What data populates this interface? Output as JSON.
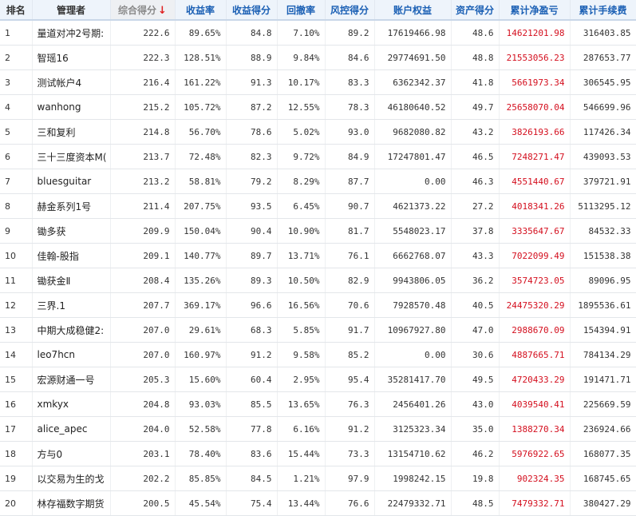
{
  "headers": {
    "rank": "排名",
    "manager": "管理者",
    "composite": "综合得分",
    "return_rate": "收益率",
    "return_score": "收益得分",
    "drawdown": "回撤率",
    "risk_score": "风控得分",
    "equity": "账户权益",
    "asset_score": "资产得分",
    "net_pnl": "累计净盈亏",
    "fees": "累计手续费"
  },
  "sort_indicator": "↓",
  "colors": {
    "header_link": "#1a5fb4",
    "pnl_text": "#d40f1e"
  },
  "rows": [
    [
      "1",
      "量道对冲2号期:",
      "222.6",
      "89.65%",
      "84.8",
      "7.10%",
      "89.2",
      "17619466.98",
      "48.6",
      "14621201.98",
      "316403.85"
    ],
    [
      "2",
      "智瑶16",
      "222.3",
      "128.51%",
      "88.9",
      "9.84%",
      "84.6",
      "29774691.50",
      "48.8",
      "21553056.23",
      "287653.77"
    ],
    [
      "3",
      "测试帐户4",
      "216.4",
      "161.22%",
      "91.3",
      "10.17%",
      "83.3",
      "6362342.37",
      "41.8",
      "5661973.34",
      "306545.95"
    ],
    [
      "4",
      "wanhong",
      "215.2",
      "105.72%",
      "87.2",
      "12.55%",
      "78.3",
      "46180640.52",
      "49.7",
      "25658070.04",
      "546699.96"
    ],
    [
      "5",
      "三和复利",
      "214.8",
      "56.70%",
      "78.6",
      "5.02%",
      "93.0",
      "9682080.82",
      "43.2",
      "3826193.66",
      "117426.34"
    ],
    [
      "6",
      "三十三度资本M(",
      "213.7",
      "72.48%",
      "82.3",
      "9.72%",
      "84.9",
      "17247801.47",
      "46.5",
      "7248271.47",
      "439093.53"
    ],
    [
      "7",
      "bluesguitar",
      "213.2",
      "58.81%",
      "79.2",
      "8.29%",
      "87.7",
      "0.00",
      "46.3",
      "4551440.67",
      "379721.91"
    ],
    [
      "8",
      "赫金系列1号",
      "211.4",
      "207.75%",
      "93.5",
      "6.45%",
      "90.7",
      "4621373.22",
      "27.2",
      "4018341.26",
      "5113295.12"
    ],
    [
      "9",
      "锄多获",
      "209.9",
      "150.04%",
      "90.4",
      "10.90%",
      "81.7",
      "5548023.17",
      "37.8",
      "3335647.67",
      "84532.33"
    ],
    [
      "10",
      "佳翰-股指",
      "209.1",
      "140.77%",
      "89.7",
      "13.71%",
      "76.1",
      "6662768.07",
      "43.3",
      "7022099.49",
      "151538.38"
    ],
    [
      "11",
      "锄获金Ⅱ",
      "208.4",
      "135.26%",
      "89.3",
      "10.50%",
      "82.9",
      "9943806.05",
      "36.2",
      "3574723.05",
      "89096.95"
    ],
    [
      "12",
      "三界.1",
      "207.7",
      "369.17%",
      "96.6",
      "16.56%",
      "70.6",
      "7928570.48",
      "40.5",
      "24475320.29",
      "1895536.61"
    ],
    [
      "13",
      "中期大成稳健2:",
      "207.0",
      "29.61%",
      "68.3",
      "5.85%",
      "91.7",
      "10967927.80",
      "47.0",
      "2988670.09",
      "154394.91"
    ],
    [
      "14",
      "leo7hcn",
      "207.0",
      "160.97%",
      "91.2",
      "9.58%",
      "85.2",
      "0.00",
      "30.6",
      "4887665.71",
      "784134.29"
    ],
    [
      "15",
      "宏源财通一号",
      "205.3",
      "15.60%",
      "60.4",
      "2.95%",
      "95.4",
      "35281417.70",
      "49.5",
      "4720433.29",
      "191471.71"
    ],
    [
      "16",
      "xmkyx",
      "204.8",
      "93.03%",
      "85.5",
      "13.65%",
      "76.3",
      "2456401.26",
      "43.0",
      "4039540.41",
      "225669.59"
    ],
    [
      "17",
      "alice_apec",
      "204.0",
      "52.58%",
      "77.8",
      "6.16%",
      "91.2",
      "3125323.34",
      "35.0",
      "1388270.34",
      "236924.66"
    ],
    [
      "18",
      "方与0",
      "203.1",
      "78.40%",
      "83.6",
      "15.44%",
      "73.3",
      "13154710.62",
      "46.2",
      "5976922.65",
      "168077.35"
    ],
    [
      "19",
      "以交易为生的戈",
      "202.2",
      "85.85%",
      "84.5",
      "1.21%",
      "97.9",
      "1998242.15",
      "19.8",
      "902324.35",
      "168745.65"
    ],
    [
      "20",
      "林存福数字期货",
      "200.5",
      "45.54%",
      "75.4",
      "13.44%",
      "76.6",
      "22479332.71",
      "48.5",
      "7479332.71",
      "380427.29"
    ]
  ]
}
